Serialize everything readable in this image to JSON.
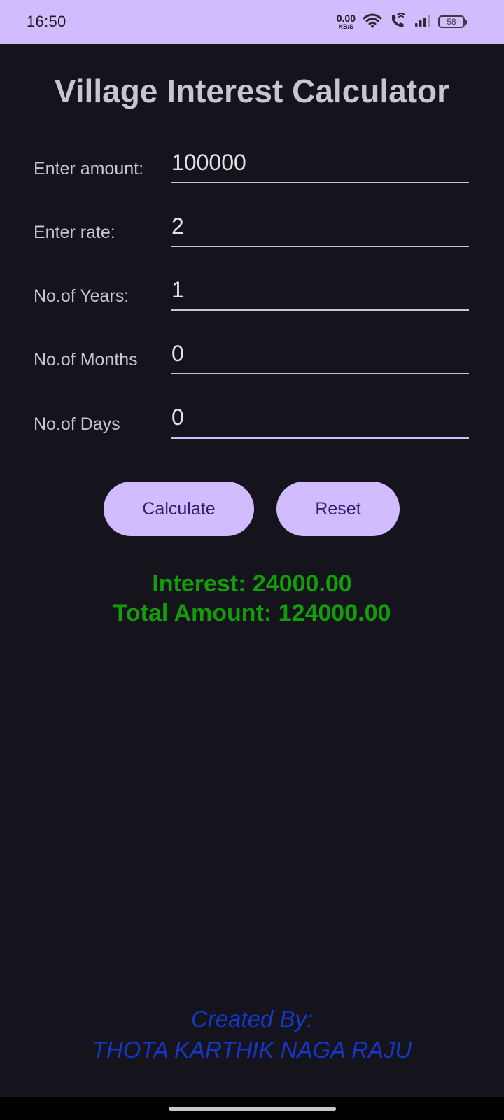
{
  "status_bar": {
    "time": "16:50",
    "net_speed_value": "0.00",
    "net_speed_unit": "KB/S",
    "battery_level": "58",
    "icons": [
      "wifi-icon",
      "wifi-call-icon",
      "signal-icon",
      "battery-icon"
    ]
  },
  "app": {
    "title": "Village Interest Calculator"
  },
  "form": {
    "amount_label": "Enter amount:",
    "amount_value": "100000",
    "rate_label": "Enter rate:",
    "rate_value": "2",
    "years_label": "No.of Years:",
    "years_value": "1",
    "months_label": "No.of Months",
    "months_value": "0",
    "days_label": "No.of Days",
    "days_value": "0"
  },
  "buttons": {
    "calculate_label": "Calculate",
    "reset_label": "Reset"
  },
  "result": {
    "interest_text": "Interest: 24000.00",
    "total_text": "Total Amount: 124000.00"
  },
  "footer": {
    "credit_line1": "Created By:",
    "credit_line2": "THOTA KARTHIK NAGA RAJU"
  },
  "colors": {
    "background": "#15131b",
    "accent": "#d0bcfe",
    "result_green": "#139d0b",
    "credit_blue": "#1636c4"
  }
}
